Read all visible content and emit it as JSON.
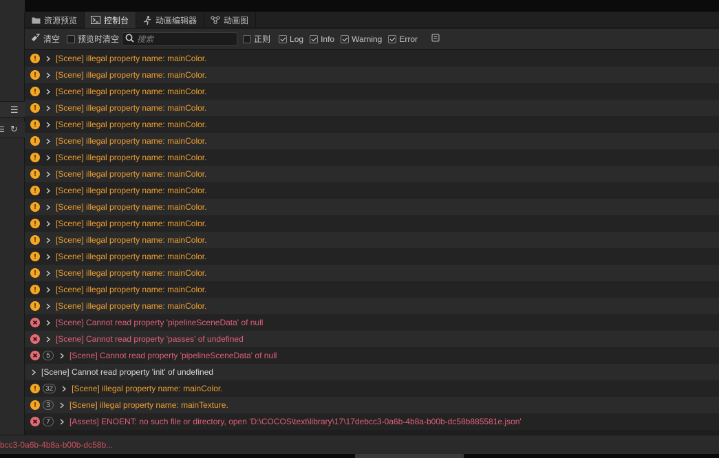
{
  "tabs": [
    {
      "label": "资源预览",
      "icon": "folder-icon",
      "active": false
    },
    {
      "label": "控制台",
      "icon": "terminal-icon",
      "active": true
    },
    {
      "label": "动画编辑器",
      "icon": "run-icon",
      "active": false
    },
    {
      "label": "动画图",
      "icon": "graph-icon",
      "active": false
    }
  ],
  "toolbar": {
    "clear_label": "清空",
    "clear_on_preview_label": "预览时清空",
    "search_placeholder": "搜索",
    "regex_label": "正则",
    "log_label": "Log",
    "info_label": "Info",
    "warning_label": "Warning",
    "error_label": "Error"
  },
  "logs": [
    {
      "level": "warn",
      "count": "",
      "text": "[Scene] illegal property name: mainColor."
    },
    {
      "level": "warn",
      "count": "",
      "text": "[Scene] illegal property name: mainColor."
    },
    {
      "level": "warn",
      "count": "",
      "text": "[Scene] illegal property name: mainColor."
    },
    {
      "level": "warn",
      "count": "",
      "text": "[Scene] illegal property name: mainColor."
    },
    {
      "level": "warn",
      "count": "",
      "text": "[Scene] illegal property name: mainColor."
    },
    {
      "level": "warn",
      "count": "",
      "text": "[Scene] illegal property name: mainColor."
    },
    {
      "level": "warn",
      "count": "",
      "text": "[Scene] illegal property name: mainColor."
    },
    {
      "level": "warn",
      "count": "",
      "text": "[Scene] illegal property name: mainColor."
    },
    {
      "level": "warn",
      "count": "",
      "text": "[Scene] illegal property name: mainColor."
    },
    {
      "level": "warn",
      "count": "",
      "text": "[Scene] illegal property name: mainColor."
    },
    {
      "level": "warn",
      "count": "",
      "text": "[Scene] illegal property name: mainColor."
    },
    {
      "level": "warn",
      "count": "",
      "text": "[Scene] illegal property name: mainColor."
    },
    {
      "level": "warn",
      "count": "",
      "text": "[Scene] illegal property name: mainColor."
    },
    {
      "level": "warn",
      "count": "",
      "text": "[Scene] illegal property name: mainColor."
    },
    {
      "level": "warn",
      "count": "",
      "text": "[Scene] illegal property name: mainColor."
    },
    {
      "level": "warn",
      "count": "",
      "text": "[Scene] illegal property name: mainColor."
    },
    {
      "level": "err",
      "count": "",
      "text": "[Scene] Cannot read property 'pipelineSceneData' of null"
    },
    {
      "level": "err",
      "count": "",
      "text": "[Scene] Cannot read property 'passes' of undefined"
    },
    {
      "level": "err",
      "count": "5",
      "text": "[Scene] Cannot read property 'pipelineSceneData' of null"
    },
    {
      "level": "log",
      "count": "",
      "text": "[Scene] Cannot read property 'init' of undefined"
    },
    {
      "level": "warn",
      "count": "32",
      "text": "[Scene] illegal property name: mainColor."
    },
    {
      "level": "warn",
      "count": "3",
      "text": "[Scene] illegal property name: mainTexture."
    },
    {
      "level": "err",
      "count": "7",
      "text": "[Assets] ENOENT: no such file or directory, open 'D:\\COCOS\\text\\library\\17\\17debcc3-0a6b-4b8a-b00b-dc58b885581e.json'"
    }
  ],
  "statusbar": {
    "text": "bcc3-0a6b-4b8a-b00b-dc58b..."
  },
  "colors": {
    "warning": "#f0a030",
    "error": "#e0607a",
    "log": "#d6d6d6"
  }
}
